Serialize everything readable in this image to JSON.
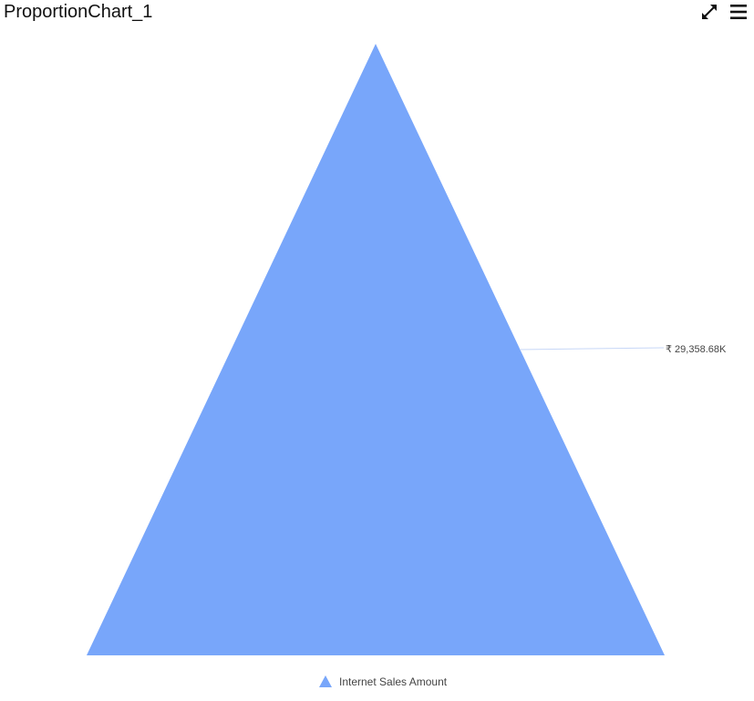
{
  "header": {
    "title": "ProportionChart_1",
    "icons": [
      "expand-icon",
      "menu-icon"
    ]
  },
  "chart_data": {
    "type": "proportion",
    "title": "ProportionChart_1",
    "series": [
      {
        "name": "Internet Sales Amount",
        "value": 29358.68,
        "label": "₹ 29,358.68K",
        "color": "#78a6fa"
      }
    ],
    "legend": {
      "position": "bottom",
      "items": [
        "Internet Sales Amount"
      ]
    },
    "connector_color": "#c7d7f7"
  }
}
